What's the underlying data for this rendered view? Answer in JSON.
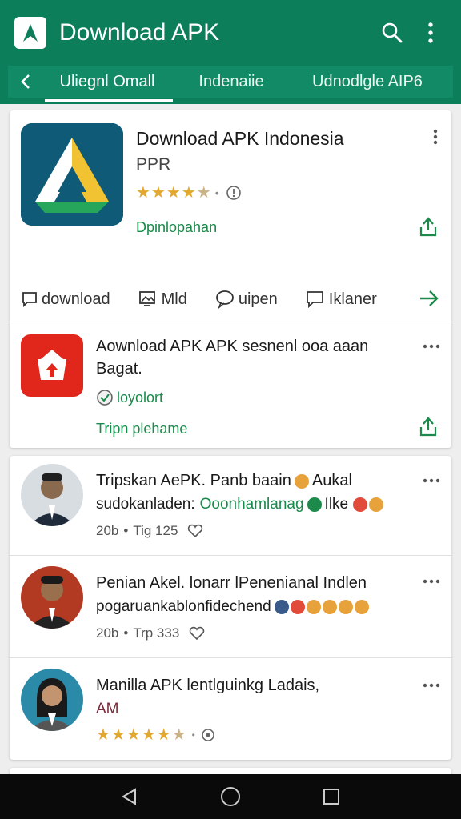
{
  "app_bar": {
    "title": "Download APK",
    "icons": [
      "logo-icon",
      "search-icon",
      "more-vert-icon"
    ]
  },
  "tabs": [
    {
      "label": "Uliegnl Omall",
      "selected": true
    },
    {
      "label": "Indenaiie",
      "selected": false
    },
    {
      "label": "Udnodlgle AIP6",
      "selected": false
    }
  ],
  "main_app": {
    "title": "Download APK Indonesia",
    "subtitle": "PPR",
    "rating_stars": 4.5,
    "link": "Dpinlopahan",
    "actions": [
      {
        "label": "download",
        "icon": "chat-bubble-icon"
      },
      {
        "label": "Mld",
        "icon": "image-icon"
      },
      {
        "label": "uipen",
        "icon": "comment-icon"
      },
      {
        "label": "Iklaner",
        "icon": "message-icon"
      }
    ]
  },
  "second_app": {
    "title": "Aownload APK APK sesnenl ooa aaan",
    "subtitle": "Bagat.",
    "badge": "loyolort",
    "link": "Tripn plehame"
  },
  "reviews": [
    {
      "line1": "Tripskan AePK. Panb baain",
      "line1_suffix": "Aukal",
      "line2_prefix": "sudokanladen:",
      "line2_green": "Ooonhamlanag",
      "line2_suffix": "Ilke",
      "meta_count": "20b",
      "meta_tag": "Tig 125"
    },
    {
      "line1": "Penian Akel. lonarr lPenenianal Indlen",
      "line2_prefix": "pogaruankablonfidechend",
      "meta_count": "20b",
      "meta_tag": "Trp 333"
    },
    {
      "line1": "Manilla APK lentlguinkg Ladais,",
      "line2_prefix": "AM",
      "rating_stars": 4.5
    }
  ],
  "colors": {
    "primary": "#0c7f5a",
    "accent_green": "#188a4a",
    "star": "#e2a72e",
    "red_icon": "#e1261c"
  }
}
